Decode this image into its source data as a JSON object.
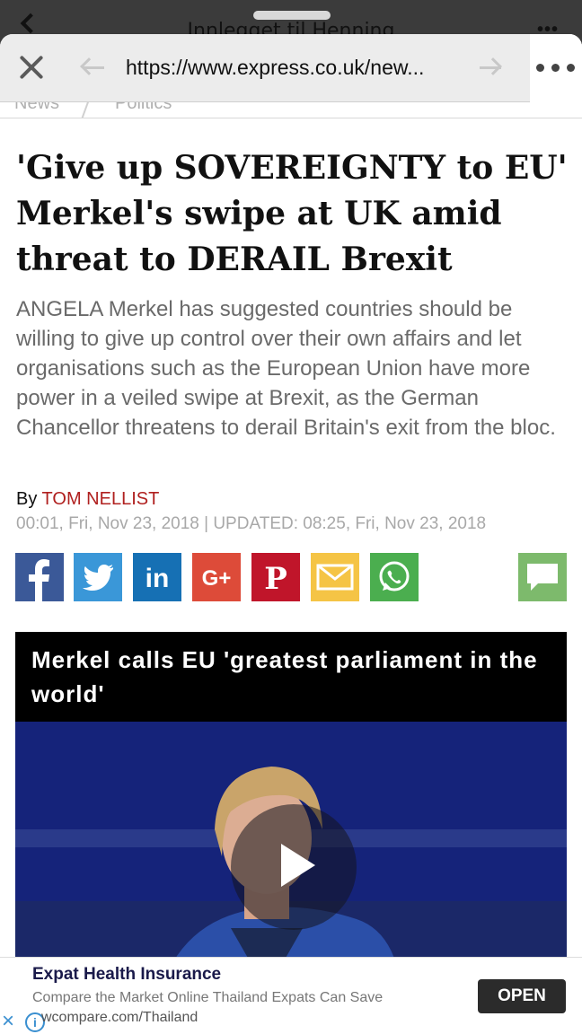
{
  "background_app": {
    "title": "Innlegget til Henning"
  },
  "browser": {
    "url": "https://www.express.co.uk/new...",
    "close_icon": "close-icon",
    "back_icon": "arrow-left-icon",
    "forward_icon": "arrow-right-icon",
    "more_icon": "more-dots-icon"
  },
  "nav": {
    "tabs": [
      "News",
      "Politics"
    ]
  },
  "article": {
    "headline": "'Give up SOVEREIGNTY to EU' Merkel's swipe at UK amid threat to DERAIL Brexit",
    "lede": "ANGELA Merkel has suggested countries should be willing to give up control over their own affairs and let organisations such as the European Union have more power in a veiled swipe at Brexit, as the German Chancellor threatens to derail Britain's exit from the bloc.",
    "byline_prefix": "By",
    "author": "TOM NELLIST",
    "dateline": "00:01, Fri, Nov 23, 2018 | UPDATED: 08:25, Fri, Nov 23, 2018"
  },
  "share": [
    {
      "name": "facebook",
      "label": "f",
      "color": "#3b5998"
    },
    {
      "name": "twitter",
      "label": "",
      "color": "#1da1f2"
    },
    {
      "name": "linkedin",
      "label": "in",
      "color": "#0e76a8"
    },
    {
      "name": "google-plus",
      "label": "G+",
      "color": "#dd4b39"
    },
    {
      "name": "pinterest",
      "label": "P",
      "color": "#bd081c"
    },
    {
      "name": "email",
      "label": "",
      "color": "#f5c242"
    },
    {
      "name": "whatsapp",
      "label": "",
      "color": "#4caf50"
    },
    {
      "name": "comments",
      "label": "",
      "color": "#7dbb6b"
    }
  ],
  "video": {
    "title": "Merkel calls EU 'greatest parliament in the world'"
  },
  "ad": {
    "title": "Expat Health Insurance",
    "description": "Compare the Market Online Thailand Expats Can Save",
    "url": "wcompare.com/Thailand",
    "button": "OPEN"
  }
}
